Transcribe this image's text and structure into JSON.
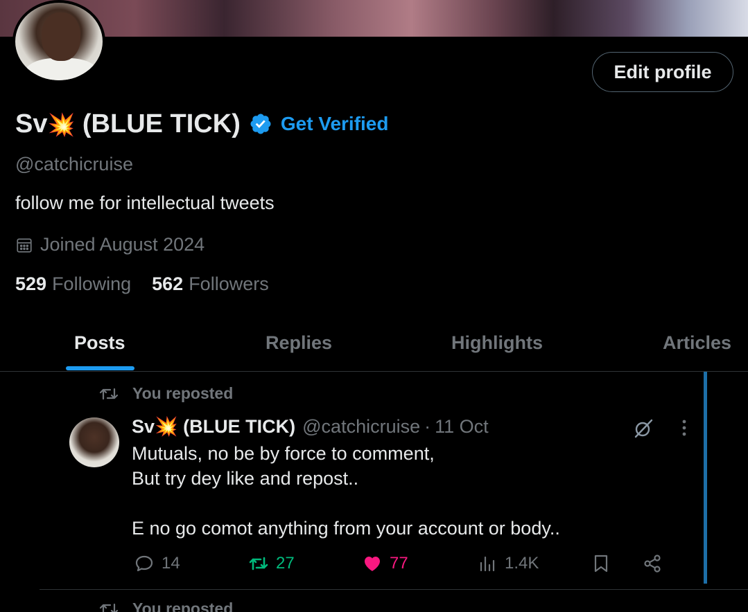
{
  "profile": {
    "name": "Sv",
    "name_emoji": "💥",
    "name_suffix": " (BLUE TICK)",
    "get_verified": "Get Verified",
    "handle": "@catchicruise",
    "bio": "follow me for intellectual tweets",
    "joined": "Joined August 2024",
    "following_count": "529",
    "following_label": "Following",
    "followers_count": "562",
    "followers_label": "Followers",
    "edit_profile": "Edit profile"
  },
  "tabs": [
    {
      "label": "Posts",
      "active": true
    },
    {
      "label": "Replies",
      "active": false
    },
    {
      "label": "Highlights",
      "active": false
    },
    {
      "label": "Articles",
      "active": false
    }
  ],
  "post": {
    "repost_label": "You reposted",
    "author_name": "Sv",
    "author_emoji": "💥",
    "author_suffix": " (BLUE TICK)",
    "author_handle": "@catchicruise",
    "separator": "·",
    "time": "11 Oct",
    "lines": [
      "Mutuals, no be by force to comment,",
      "But try dey like and repost..",
      "",
      "E no go comot anything from your account or body.."
    ],
    "replies": "14",
    "reposts": "27",
    "likes": "77",
    "views": "1.4K"
  },
  "next_post": {
    "repost_label": "You reposted"
  },
  "colors": {
    "accent": "#1d9bf0",
    "repost_green": "#00ba7c",
    "like_pink": "#f91880",
    "muted": "#71767b"
  }
}
